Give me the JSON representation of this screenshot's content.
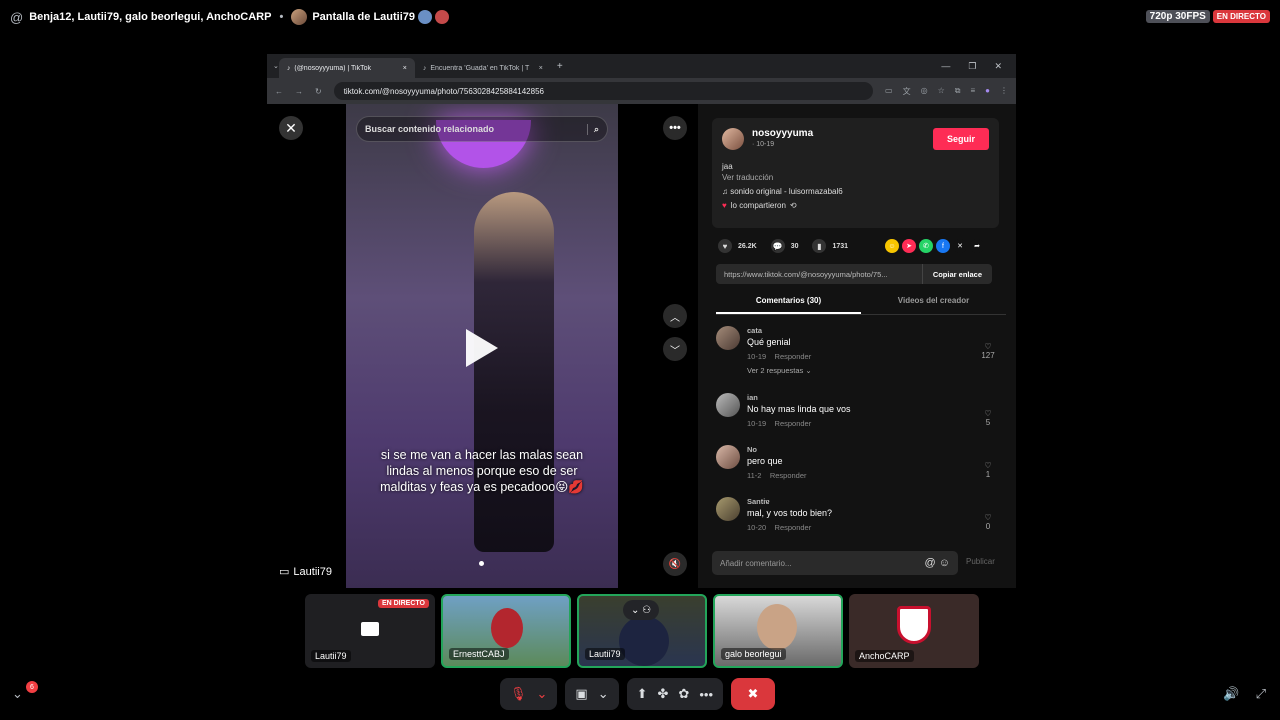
{
  "topbar": {
    "participants": "Benja12, Lautii79, galo beorlegui, AnchoCARP",
    "screen": "Pantalla de Lautii79",
    "quality": "720p 30FPS",
    "live": "EN DIRECTO"
  },
  "browser": {
    "tabs": [
      {
        "title": "(@nosoyyyuma) | TikTok",
        "close": "×"
      },
      {
        "title": "Encuentra 'Guada' en TikTok | T",
        "close": "×"
      }
    ],
    "new_tab": "+",
    "url": "tiktok.com/@nosoyyyuma/photo/7563028425884142856"
  },
  "tiktok": {
    "search_placeholder": "Buscar contenido relacionado",
    "caption": "si se me van a hacer las malas sean lindas al menos porque eso de ser malditas y feas ya es pecadooo😝💋",
    "username": "nosoyyyuma",
    "date": "· 10-19",
    "follow": "Seguir",
    "desc": "jaa",
    "translate": "Ver traducción",
    "sound": "♫ sonido original - luisormazabal6",
    "shared": "lo compartieron",
    "likes": "26.2K",
    "comments_count": "30",
    "saves": "1731",
    "link": "https://www.tiktok.com/@nosoyyyuma/photo/75...",
    "copy": "Copiar enlace",
    "tab_comments": "Comentarios (30)",
    "tab_videos": "Videos del creador",
    "comments": [
      {
        "name": "cata",
        "text": "Qué genial",
        "date": "10-19",
        "reply": "Responder",
        "likes": "127",
        "more": "Ver 2 respuestas ⌄"
      },
      {
        "name": "ian",
        "text": "No hay mas linda que vos",
        "date": "10-19",
        "reply": "Responder",
        "likes": "5",
        "more": ""
      },
      {
        "name": "No",
        "text": "pero que",
        "date": "11-2",
        "reply": "Responder",
        "likes": "1",
        "more": ""
      },
      {
        "name": "Santiɐ",
        "text": "mal, y vos todo bien?",
        "date": "10-20",
        "reply": "Responder",
        "likes": "0",
        "more": ""
      }
    ],
    "add_comment": "Añadir comentario...",
    "publish": "Publicar"
  },
  "stream_label": "Lautii79",
  "tiles": [
    {
      "name": "Lautii79",
      "live": "EN DIRECTO"
    },
    {
      "name": "ErnesttCABJ"
    },
    {
      "name": "Lautii79"
    },
    {
      "name": "galo beorlegui"
    },
    {
      "name": "AnchoCARP"
    }
  ],
  "notif_count": "6"
}
